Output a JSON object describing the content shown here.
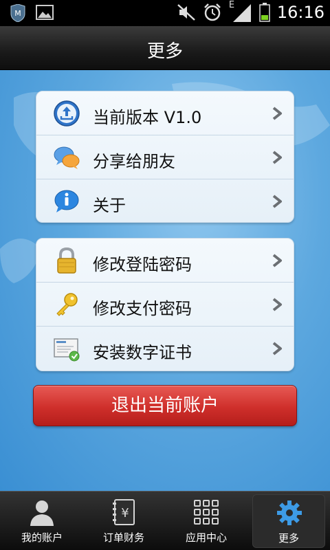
{
  "status_bar": {
    "time": "16:16",
    "network_label": "E",
    "left_icons": [
      "app-notification-icon",
      "image-notification-icon"
    ],
    "right_icons": [
      "mute-icon",
      "alarm-icon",
      "signal-icon",
      "battery-icon"
    ]
  },
  "header": {
    "title": "更多"
  },
  "groups": [
    {
      "items": [
        {
          "label": "当前版本 V1.0",
          "icon": "upload-icon"
        },
        {
          "label": "分享给朋友",
          "icon": "chat-bubbles-icon"
        },
        {
          "label": "关于",
          "icon": "info-icon"
        }
      ]
    },
    {
      "items": [
        {
          "label": "修改登陆密码",
          "icon": "lock-icon"
        },
        {
          "label": "修改支付密码",
          "icon": "key-icon"
        },
        {
          "label": "安装数字证书",
          "icon": "certificate-icon"
        }
      ]
    }
  ],
  "logout_button": {
    "label": "退出当前账户"
  },
  "tabs": [
    {
      "label": "我的账户",
      "icon": "person-icon",
      "active": false
    },
    {
      "label": "订单财务",
      "icon": "yen-book-icon",
      "active": false
    },
    {
      "label": "应用中心",
      "icon": "grid-icon",
      "active": false
    },
    {
      "label": "更多",
      "icon": "gear-icon",
      "active": true
    }
  ],
  "colors": {
    "accent_blue": "#3a8fd3",
    "logout_red": "#cf2f2b",
    "header_bg": "#1a1a1a"
  }
}
